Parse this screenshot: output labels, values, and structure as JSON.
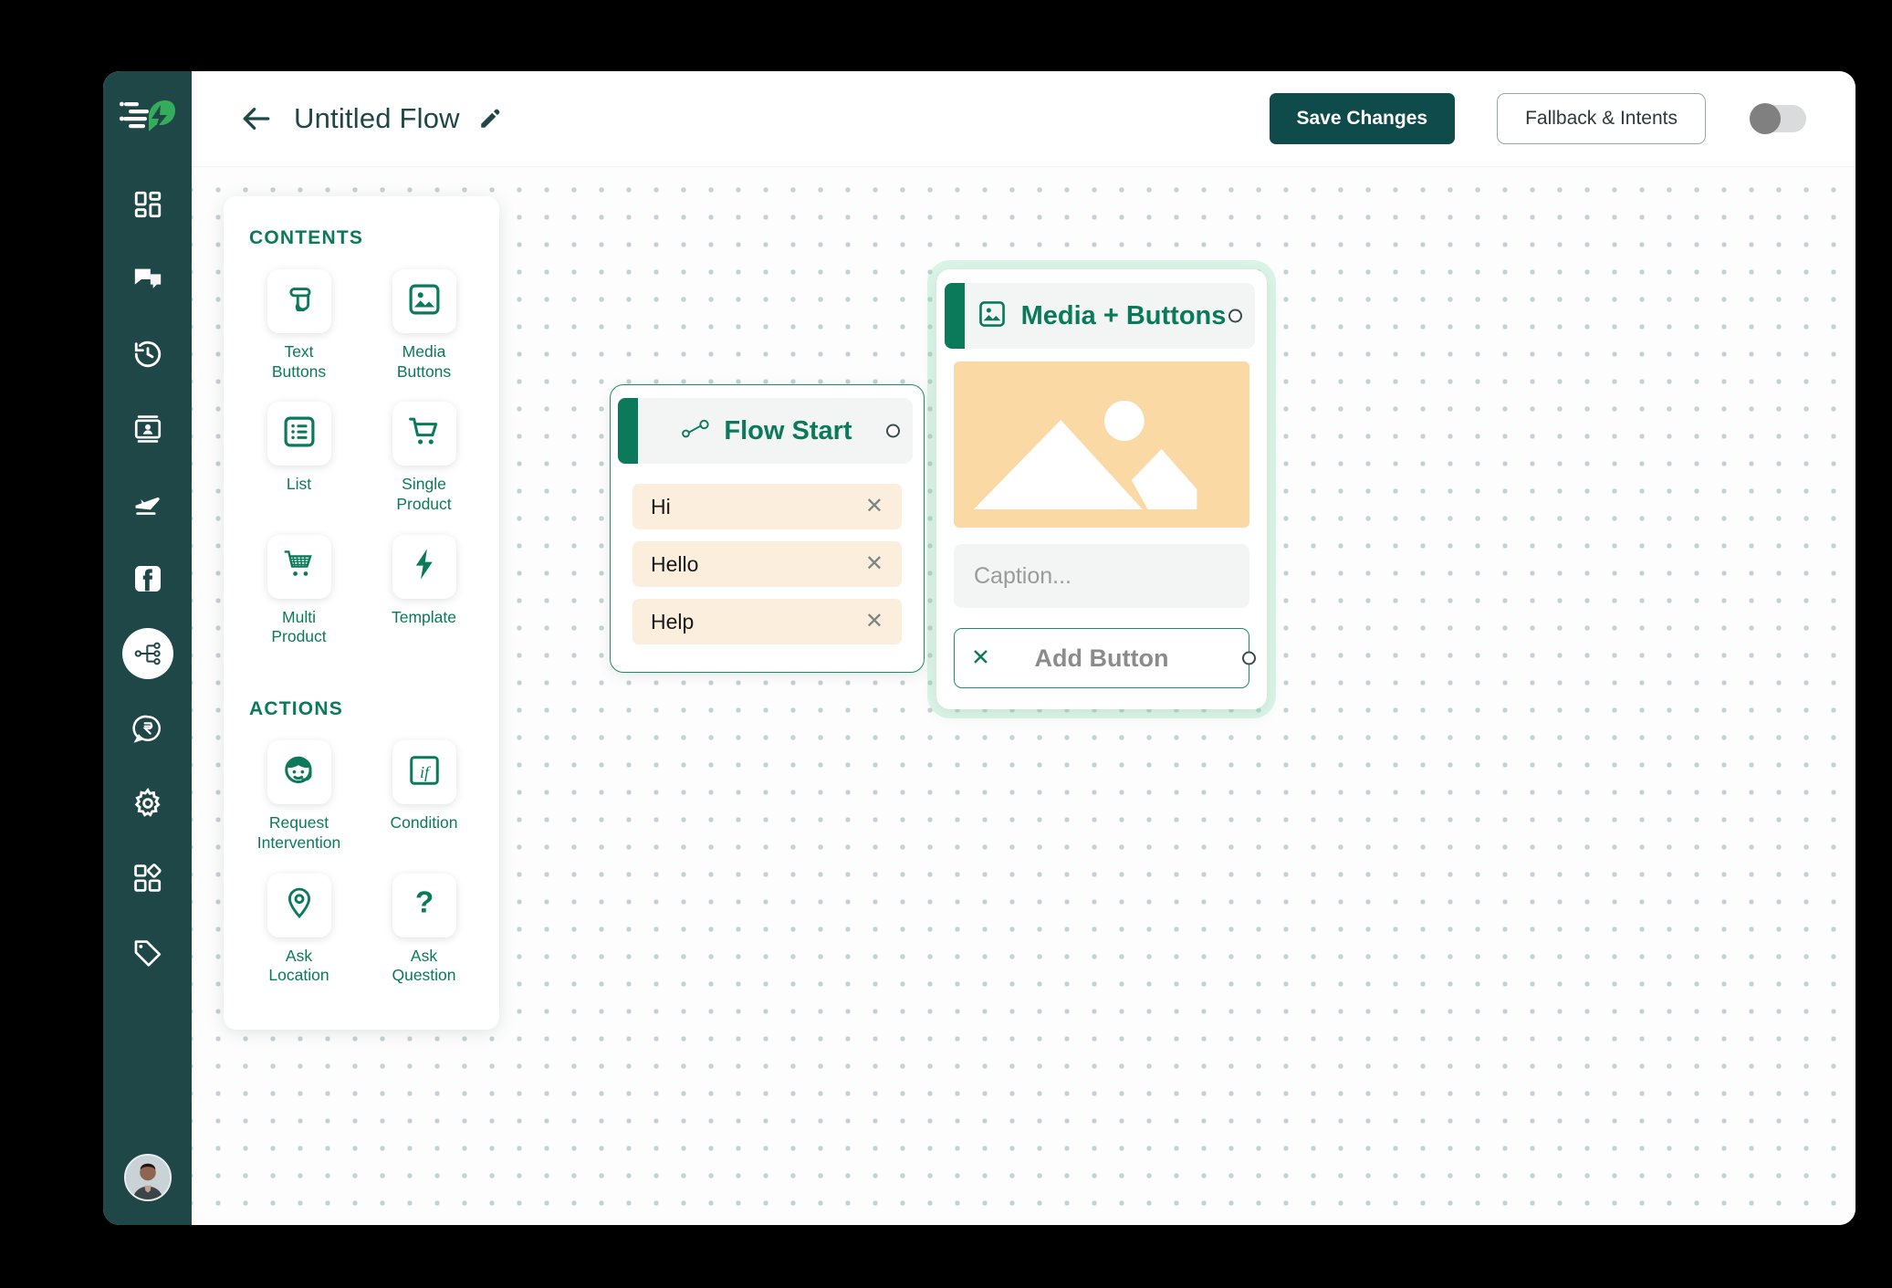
{
  "app": {
    "brand_logo_icon": "chat-bolt-logo",
    "accent_green": "#0b7a5a",
    "sidebar_bg": "#1f4747",
    "node_border": "#1f8a6b"
  },
  "sidebar": {
    "items": [
      {
        "name": "dashboard",
        "icon": "dashboard-icon",
        "active": false
      },
      {
        "name": "conversations",
        "icon": "chat-bubbles-icon",
        "active": false
      },
      {
        "name": "history",
        "icon": "history-clock-icon",
        "active": false
      },
      {
        "name": "contacts",
        "icon": "contact-card-icon",
        "active": false
      },
      {
        "name": "broadcast",
        "icon": "paper-plane-icon",
        "active": false
      },
      {
        "name": "facebook",
        "icon": "facebook-icon",
        "active": false
      },
      {
        "name": "flows",
        "icon": "flow-nodes-icon",
        "active": true
      },
      {
        "name": "payments",
        "icon": "rupee-chat-icon",
        "active": false
      },
      {
        "name": "settings",
        "icon": "gear-icon",
        "active": false
      },
      {
        "name": "integrations",
        "icon": "widgets-icon",
        "active": false
      },
      {
        "name": "tags",
        "icon": "tag-icon",
        "active": false
      }
    ],
    "avatar_alt": "user-avatar"
  },
  "topbar": {
    "back_icon": "arrow-left-icon",
    "title": "Untitled Flow",
    "edit_icon": "pencil-icon",
    "save_label": "Save Changes",
    "fallback_label": "Fallback & Intents",
    "toggle_state": "off"
  },
  "palette": {
    "contents_heading": "CONTENTS",
    "actions_heading": "ACTIONS",
    "contents": [
      {
        "label": "Text\nButtons",
        "label_lines": [
          "Text",
          "Buttons"
        ],
        "icon": "tap-finger-icon"
      },
      {
        "label": "Media\nButtons",
        "label_lines": [
          "Media",
          "Buttons"
        ],
        "icon": "image-icon"
      },
      {
        "label": "List",
        "label_lines": [
          "List"
        ],
        "icon": "list-icon"
      },
      {
        "label": "Single\nProduct",
        "label_lines": [
          "Single",
          "Product"
        ],
        "icon": "cart-icon"
      },
      {
        "label": "Multi\nProduct",
        "label_lines": [
          "Multi",
          "Product"
        ],
        "icon": "cart-filled-icon"
      },
      {
        "label": "Template",
        "label_lines": [
          "Template"
        ],
        "icon": "bolt-icon"
      }
    ],
    "actions": [
      {
        "label": "Request\nIntervention",
        "label_lines": [
          "Request",
          "Intervention"
        ],
        "icon": "agent-face-icon"
      },
      {
        "label": "Condition",
        "label_lines": [
          "Condition"
        ],
        "icon": "if-box-icon"
      },
      {
        "label": "Ask\nLocation",
        "label_lines": [
          "Ask",
          "Location"
        ],
        "icon": "map-pin-icon"
      },
      {
        "label": "Ask\nQuestion",
        "label_lines": [
          "Ask",
          "Question"
        ],
        "icon": "question-mark-icon"
      }
    ]
  },
  "canvas": {
    "cursor_icon": "grab-hand-cursor",
    "nodes": [
      {
        "id": "flow-start",
        "title": "Flow Start",
        "icon": "flow-start-icon",
        "selected": false,
        "quick_replies": [
          {
            "text": "Hi",
            "remove_icon": "close-icon"
          },
          {
            "text": "Hello",
            "remove_icon": "close-icon"
          },
          {
            "text": "Help",
            "remove_icon": "close-icon"
          }
        ]
      },
      {
        "id": "media-buttons",
        "title": "Media + Buttons",
        "icon": "image-icon",
        "selected": true,
        "media_placeholder_icon": "image-placeholder-icon",
        "caption_placeholder": "Caption...",
        "add_button_label": "Add Button",
        "add_button_remove_icon": "close-icon"
      }
    ]
  }
}
